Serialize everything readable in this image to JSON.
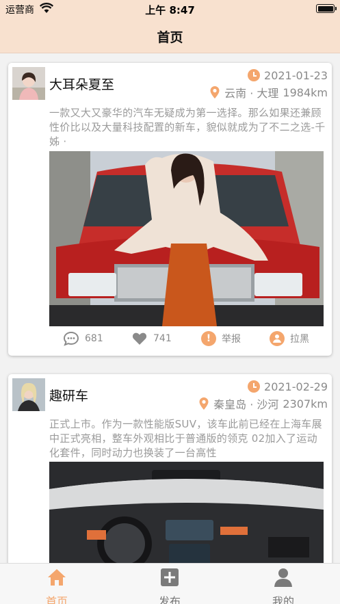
{
  "status_bar": {
    "carrier": "运营商",
    "time": "上午 8:47"
  },
  "nav": {
    "title": "首页"
  },
  "posts": [
    {
      "username": "大耳朵夏至",
      "date": "2021-01-23",
      "location": "云南 · 大理",
      "distance": "1984km",
      "text": "一款又大又豪华的汽车无疑成为第一选择。那么如果还兼顾性价比以及大量科技配置的新车，貌似就成为了不二之选-千姊 ·",
      "comments": "681",
      "likes": "741",
      "report_label": "举报",
      "block_label": "拉黑"
    },
    {
      "username": "趣研车",
      "date": "2021-02-29",
      "location": "秦皇岛 · 沙河",
      "distance": "2307km",
      "text": "正式上市。作为一款性能版SUV，该车此前已经在上海车展中正式亮相，整车外观相比于普通版的领克 02加入了运动化套件，同时动力也换装了一台高性"
    }
  ],
  "tabbar": {
    "home": "首页",
    "publish": "发布",
    "mine": "我的"
  },
  "colors": {
    "accent": "#f4a66d",
    "header_bg": "#f8e1cf"
  }
}
